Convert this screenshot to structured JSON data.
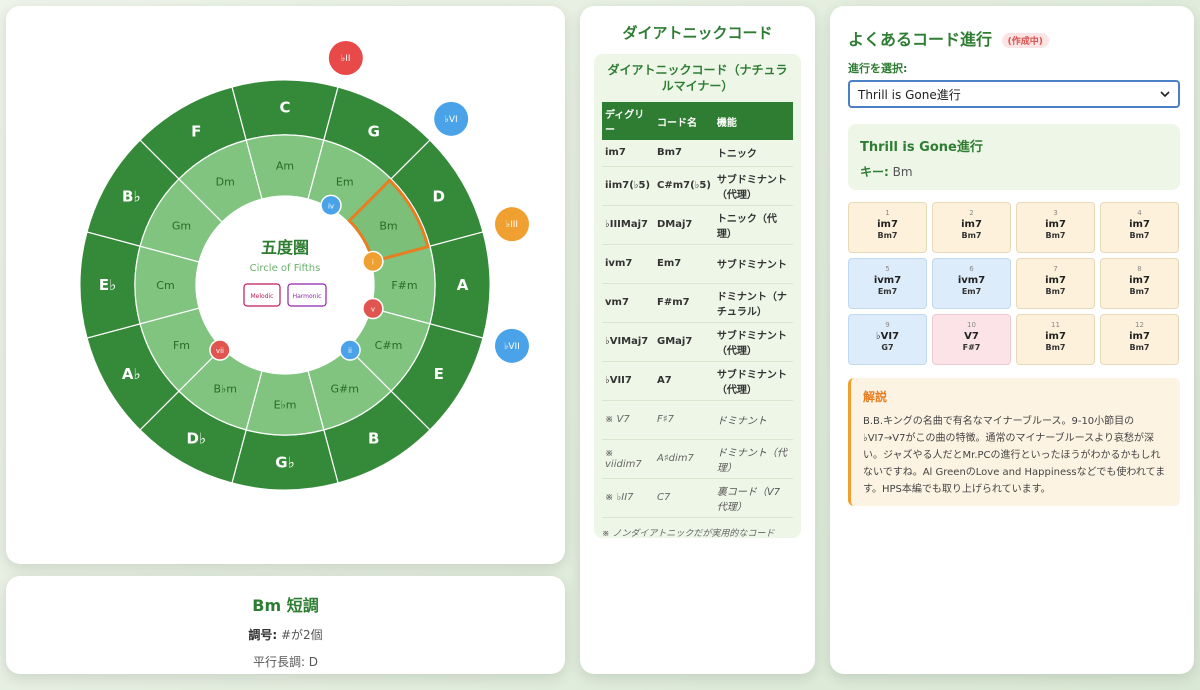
{
  "wheel": {
    "title": "五度圏",
    "subtitle": "Circle of Fifths",
    "major_keys": [
      "C",
      "G",
      "D",
      "A",
      "E",
      "B",
      "G♭",
      "D♭",
      "A♭",
      "E♭",
      "B♭",
      "F"
    ],
    "minor_keys": [
      "Am",
      "Em",
      "Bm",
      "F#m",
      "C#m",
      "G#m",
      "E♭m",
      "B♭m",
      "Fm",
      "Cm",
      "Gm",
      "Dm"
    ],
    "buttons": {
      "melodic": "Melodic",
      "harmonic": "Harmonic"
    },
    "selected_index": 2,
    "degree_markers": [
      {
        "label": "iv",
        "color": "#4aa3e8"
      },
      {
        "label": "i",
        "color": "#f0a030"
      },
      {
        "label": "v",
        "color": "#e0554f"
      },
      {
        "label": "ii",
        "color": "#4aa3e8"
      },
      {
        "label": "vii",
        "color": "#e0554f"
      }
    ],
    "outer_markers": [
      {
        "label": "♭II",
        "color": "#e84a4a"
      },
      {
        "label": "♭VI",
        "color": "#4aa3e8"
      },
      {
        "label": "♭III",
        "color": "#f0a030"
      },
      {
        "label": "♭VII",
        "color": "#4aa3e8"
      }
    ],
    "colors": {
      "outer": "#358a3a",
      "inner": "#80c480",
      "highlight": "#e67e22"
    }
  },
  "key_info": {
    "title": "Bm 短調",
    "signature_label": "調号:",
    "signature_value": "#が2個",
    "relative": "平行長調: D"
  },
  "diatonic": {
    "title": "ダイアトニックコード",
    "subtitle": "ダイアトニックコード（ナチュラルマイナー）",
    "headers": [
      "ディグリー",
      "コード名",
      "機能"
    ],
    "rows": [
      {
        "degree": "im7",
        "chord": "Bm7",
        "func": "トニック"
      },
      {
        "degree": "iim7(♭5)",
        "chord": "C#m7(♭5)",
        "func": "サブドミナント（代理）"
      },
      {
        "degree": "♭IIIMaj7",
        "chord": "DMaj7",
        "func": "トニック（代理）"
      },
      {
        "degree": "ivm7",
        "chord": "Em7",
        "func": "サブドミナント"
      },
      {
        "degree": "vm7",
        "chord": "F#m7",
        "func": "ドミナント（ナチュラル）"
      },
      {
        "degree": "♭VIMaj7",
        "chord": "GMaj7",
        "func": "サブドミナント（代理）"
      },
      {
        "degree": "♭VII7",
        "chord": "A7",
        "func": "サブドミナント（代理）"
      }
    ],
    "alt_rows": [
      {
        "degree": "※ V7",
        "chord": "F♯7",
        "func": "ドミナント"
      },
      {
        "degree": "※ viidim7",
        "chord": "A♯dim7",
        "func": "ドミナント（代理）"
      },
      {
        "degree": "※ ♭II7",
        "chord": "C7",
        "func": "裏コード（V7代理）"
      }
    ],
    "note": "※ ノンダイアトニックだが実用的なコード"
  },
  "progression": {
    "title": "よくあるコード進行",
    "badge": "(作成中)",
    "select_label": "進行を選択:",
    "selected": "Thrill is Gone進行",
    "info_name": "Thrill is Gone進行",
    "info_key_label": "キー:",
    "info_key_value": "Bm",
    "bars": [
      {
        "n": "1",
        "degree": "im7",
        "chord": "Bm7",
        "type": "tonic"
      },
      {
        "n": "2",
        "degree": "im7",
        "chord": "Bm7",
        "type": "tonic"
      },
      {
        "n": "3",
        "degree": "im7",
        "chord": "Bm7",
        "type": "tonic"
      },
      {
        "n": "4",
        "degree": "im7",
        "chord": "Bm7",
        "type": "tonic"
      },
      {
        "n": "5",
        "degree": "ivm7",
        "chord": "Em7",
        "type": "sub"
      },
      {
        "n": "6",
        "degree": "ivm7",
        "chord": "Em7",
        "type": "sub"
      },
      {
        "n": "7",
        "degree": "im7",
        "chord": "Bm7",
        "type": "tonic"
      },
      {
        "n": "8",
        "degree": "im7",
        "chord": "Bm7",
        "type": "tonic"
      },
      {
        "n": "9",
        "degree": "♭VI7",
        "chord": "G7",
        "type": "sub"
      },
      {
        "n": "10",
        "degree": "V7",
        "chord": "F#7",
        "type": "dom"
      },
      {
        "n": "11",
        "degree": "im7",
        "chord": "Bm7",
        "type": "tonic"
      },
      {
        "n": "12",
        "degree": "im7",
        "chord": "Bm7",
        "type": "tonic"
      }
    ],
    "explanation_title": "解説",
    "explanation": "B.B.キングの名曲で有名なマイナーブルース。9-10小節目の♭VI7→V7がこの曲の特徴。通常のマイナーブルースより哀愁が深い。ジャズやる人だとMr.PCの進行といったほうがわかるかもしれないですね。Al GreenのLove and Happinessなどでも使われてます。HPS本編でも取り上げられています。"
  }
}
